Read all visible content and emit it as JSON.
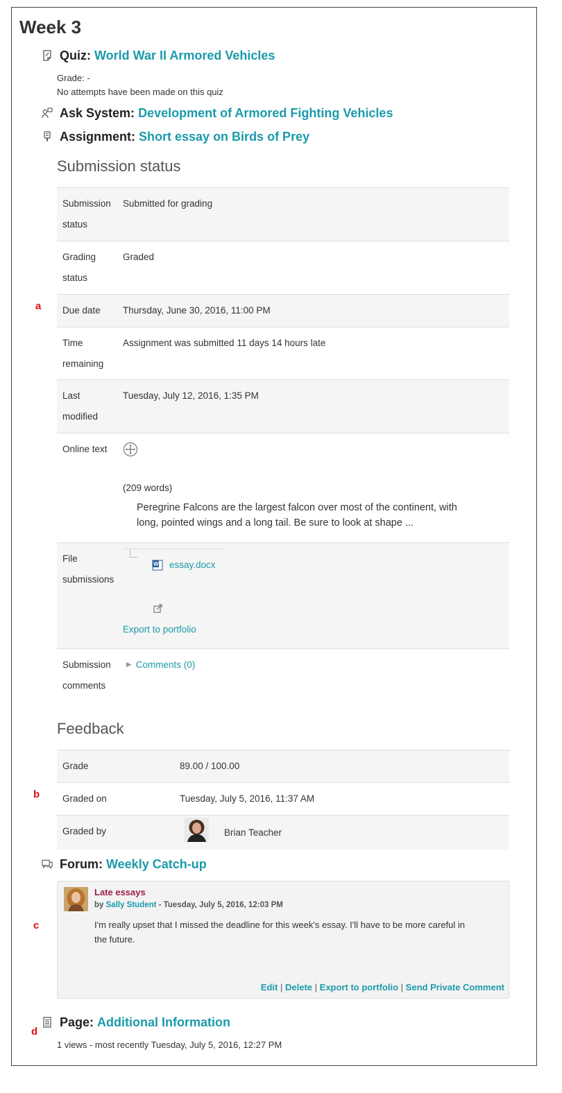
{
  "week": {
    "title": "Week 3"
  },
  "quiz": {
    "type": "Quiz:",
    "name": "World War II Armored Vehicles",
    "grade": "Grade: -",
    "attempts": "No attempts have been made on this quiz"
  },
  "ask": {
    "type": "Ask System:",
    "name": "Development of Armored Fighting Vehicles"
  },
  "assignment": {
    "type": "Assignment:",
    "name": "Short essay on Birds of Prey"
  },
  "submission": {
    "heading": "Submission status",
    "rows": [
      {
        "label_1": "Submission",
        "label_2": "status",
        "value": "Submitted for grading"
      },
      {
        "label_1": "Grading",
        "label_2": "status",
        "value": "Graded"
      },
      {
        "label_1": "Due date",
        "value": "Thursday, June 30, 2016, 11:00 PM"
      },
      {
        "label_1": "Time",
        "label_2": "remaining",
        "value": "Assignment was submitted 11 days 14 hours late"
      },
      {
        "label_1": "Last",
        "label_2": "modified",
        "value": "Tuesday, July 12, 2016, 1:35 PM"
      }
    ],
    "online_text": {
      "label": "Online text",
      "word_count": "(209 words)",
      "excerpt_1": "Peregrine Falcons are the largest falcon over most of the continent, with",
      "excerpt_2": "long, pointed wings and a long tail. Be sure to look at shape ..."
    },
    "files": {
      "label_1": "File",
      "label_2": "submissions",
      "filename": "essay.docx",
      "export": "Export to portfolio"
    },
    "comments": {
      "label_1": "Submission",
      "label_2": "comments",
      "link": "Comments (0)"
    }
  },
  "feedback": {
    "heading": "Feedback",
    "grade_label": "Grade",
    "grade_value": "89.00 / 100.00",
    "graded_on_label": "Graded on",
    "graded_on_value": "Tuesday, July 5, 2016, 11:37 AM",
    "graded_by_label": "Graded by",
    "graded_by_value": "Brian Teacher"
  },
  "forum": {
    "type": "Forum:",
    "name": "Weekly Catch-up",
    "post": {
      "subject": "Late essays",
      "by": "by",
      "author": "Sally Student",
      "date": " - Tuesday, July 5, 2016, 12:03 PM",
      "body_1": "I'm really upset that I missed the deadline for this week's essay. I'll have to be more careful in",
      "body_2": "the future.",
      "actions": {
        "edit": "Edit",
        "delete": "Delete",
        "export": "Export to portfolio",
        "private": "Send Private Comment",
        "sep": "|"
      }
    }
  },
  "page": {
    "type": "Page:",
    "name": "Additional Information",
    "views": "1 views - most recently Tuesday, July 5, 2016, 12:27 PM"
  },
  "markers": {
    "a": "a",
    "b": "b",
    "c": "c",
    "d": "d"
  },
  "colors": {
    "link": "#1b9aaa",
    "marker": "#e01010",
    "subject": "#9e1e4a"
  }
}
